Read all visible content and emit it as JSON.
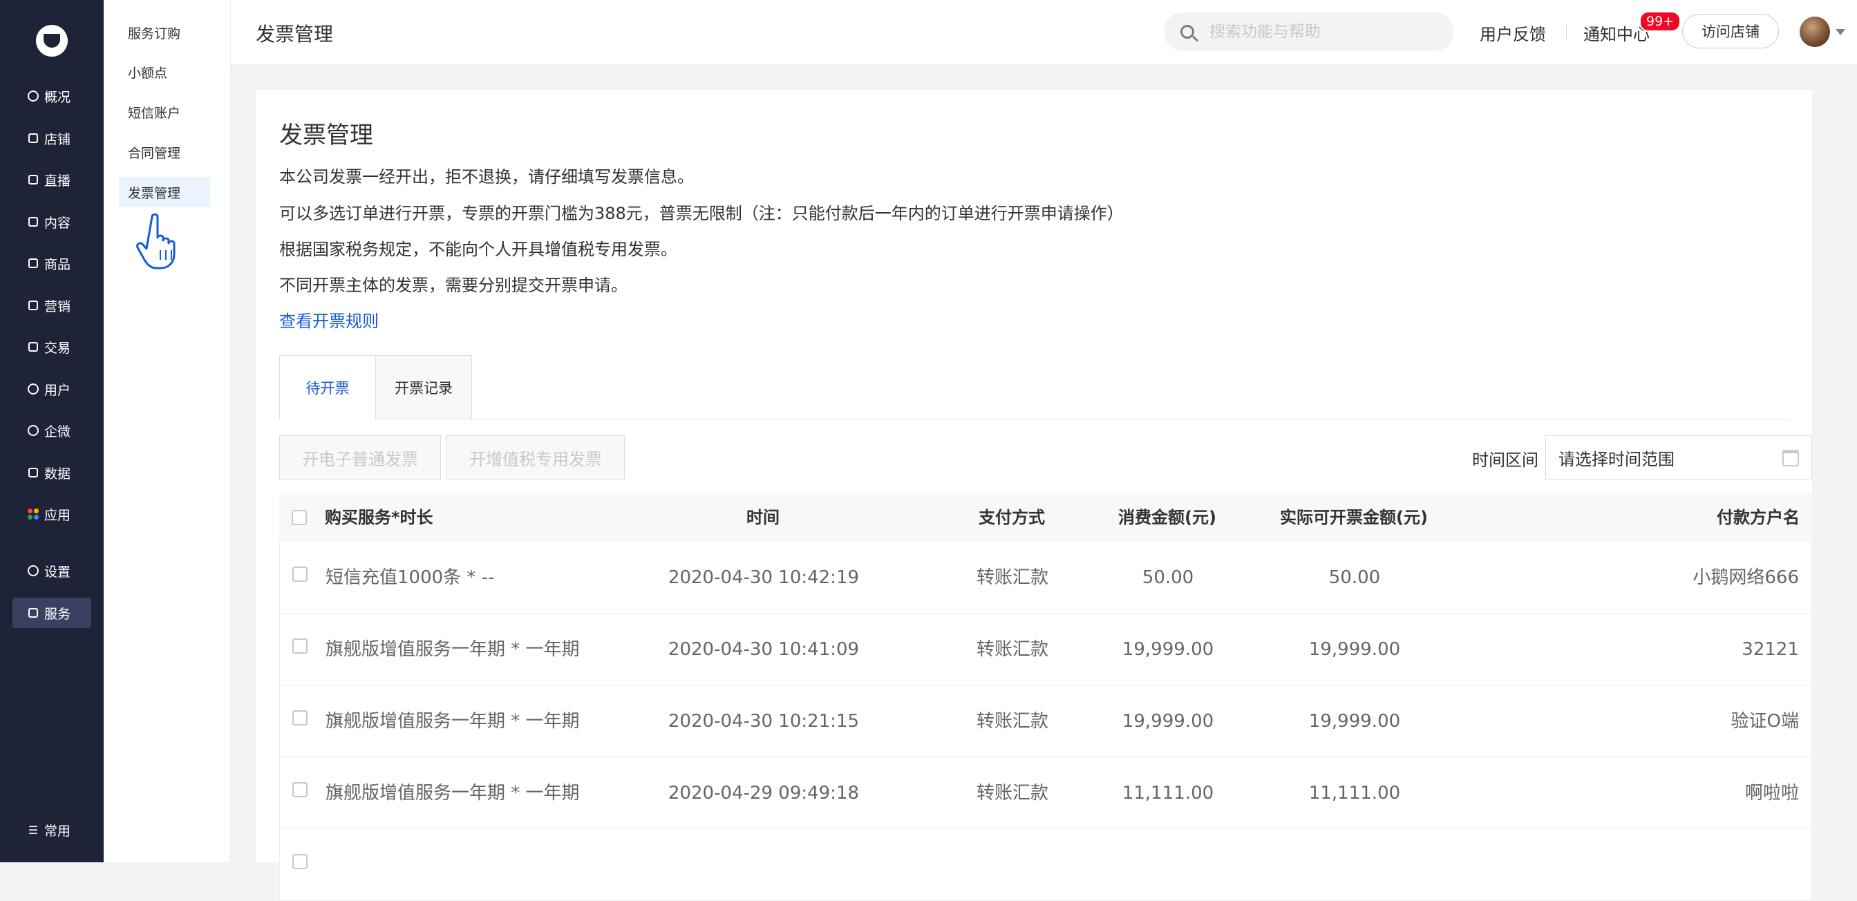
{
  "nav": {
    "items": [
      {
        "label": "概况",
        "icon": "pie-chart-icon"
      },
      {
        "label": "店铺",
        "icon": "store-icon"
      },
      {
        "label": "直播",
        "icon": "live-icon"
      },
      {
        "label": "内容",
        "icon": "document-icon"
      },
      {
        "label": "商品",
        "icon": "goods-icon"
      },
      {
        "label": "营销",
        "icon": "megaphone-icon"
      },
      {
        "label": "交易",
        "icon": "transaction-icon"
      },
      {
        "label": "用户",
        "icon": "user-icon"
      },
      {
        "label": "企微",
        "icon": "wecom-icon"
      },
      {
        "label": "数据",
        "icon": "data-icon"
      },
      {
        "label": "应用",
        "icon": "apps-icon"
      },
      {
        "label": "设置",
        "icon": "gear-icon"
      },
      {
        "label": "服务",
        "icon": "service-icon"
      }
    ],
    "bottom_label": "常用",
    "active": "服务"
  },
  "subnav": {
    "items": [
      "服务订购",
      "小额点",
      "短信账户",
      "合同管理",
      "发票管理"
    ],
    "active": "发票管理"
  },
  "topbar": {
    "title": "发票管理",
    "search_placeholder": "搜索功能与帮助",
    "feedback": "用户反馈",
    "notice": "通知中心",
    "notice_badge": "99+",
    "visit_store": "访问店铺"
  },
  "main": {
    "title": "发票管理",
    "notes": [
      "本公司发票一经开出，拒不退换，请仔细填写发票信息。",
      "可以多选订单进行开票，专票的开票门槛为388元，普票无限制（注：只能付款后一年内的订单进行开票申请操作）",
      "根据国家税务规定，不能向个人开具增值税专用发票。",
      "不同开票主体的发票，需要分别提交开票申请。"
    ],
    "rule_link": "查看开票规则",
    "tabs": [
      "待开票",
      "开票记录"
    ],
    "active_tab": "待开票",
    "buttons": {
      "normal": "开电子普通发票",
      "vat": "开增值税专用发票"
    },
    "range_label": "时间区间",
    "range_placeholder": "请选择时间范围"
  },
  "table": {
    "headers": [
      "购买服务*时长",
      "时间",
      "支付方式",
      "消费金额(元)",
      "实际可开票金额(元)",
      "付款方户名"
    ],
    "rows": [
      [
        "短信充值1000条 * --",
        "2020-04-30 10:42:19",
        "转账汇款",
        "50.00",
        "50.00",
        "小鹅网络666"
      ],
      [
        "旗舰版增值服务一年期 * 一年期",
        "2020-04-30 10:41:09",
        "转账汇款",
        "19,999.00",
        "19,999.00",
        "32121"
      ],
      [
        "旗舰版增值服务一年期 * 一年期",
        "2020-04-30 10:21:15",
        "转账汇款",
        "19,999.00",
        "19,999.00",
        "验证O端"
      ],
      [
        "旗舰版增值服务一年期 * 一年期",
        "2020-04-29 09:49:18",
        "转账汇款",
        "11,111.00",
        "11,111.00",
        "啊啦啦"
      ]
    ]
  },
  "colors": {
    "nav_bg": "#1f2338",
    "accent": "#155bd4",
    "badge": "#ee0a24"
  }
}
